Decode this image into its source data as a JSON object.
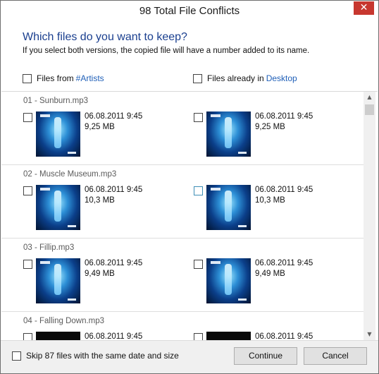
{
  "window": {
    "title": "98 Total File Conflicts",
    "close_glyph": "✕"
  },
  "header": {
    "question": "Which files do you want to keep?",
    "subtext": "If you select both versions, the copied file will have a number added to its name.",
    "left_column": {
      "prefix": "Files from",
      "link": "#Artists"
    },
    "right_column": {
      "prefix": "Files already in",
      "link": "Desktop"
    }
  },
  "files": [
    {
      "name": "01 - Sunburn.mp3",
      "left": {
        "date": "06.08.2011 9:45",
        "size": "9,25 MB"
      },
      "right": {
        "date": "06.08.2011 9:45",
        "size": "9,25 MB"
      }
    },
    {
      "name": "02 - Muscle Museum.mp3",
      "left": {
        "date": "06.08.2011 9:45",
        "size": "10,3 MB"
      },
      "right": {
        "date": "06.08.2011 9:45",
        "size": "10,3 MB"
      }
    },
    {
      "name": "03 - Fillip.mp3",
      "left": {
        "date": "06.08.2011 9:45",
        "size": "9,49 MB"
      },
      "right": {
        "date": "06.08.2011 9:45",
        "size": "9,49 MB"
      }
    },
    {
      "name": "04 - Falling Down.mp3",
      "left": {
        "date": "06.08.2011 9:45",
        "size": ""
      },
      "right": {
        "date": "06.08.2011 9:45",
        "size": ""
      }
    }
  ],
  "footer": {
    "skip_label": "Skip 87 files with the same date and size",
    "continue_label": "Continue",
    "cancel_label": "Cancel"
  },
  "icons": {
    "close": "close-icon",
    "scroll_up": "chevron-up-icon",
    "scroll_down": "chevron-down-icon",
    "album_art": "album-art-thumbnail"
  },
  "colors": {
    "accent_text": "#1a3f8f",
    "link": "#1f5fb8",
    "close_button": "#c7372f"
  }
}
